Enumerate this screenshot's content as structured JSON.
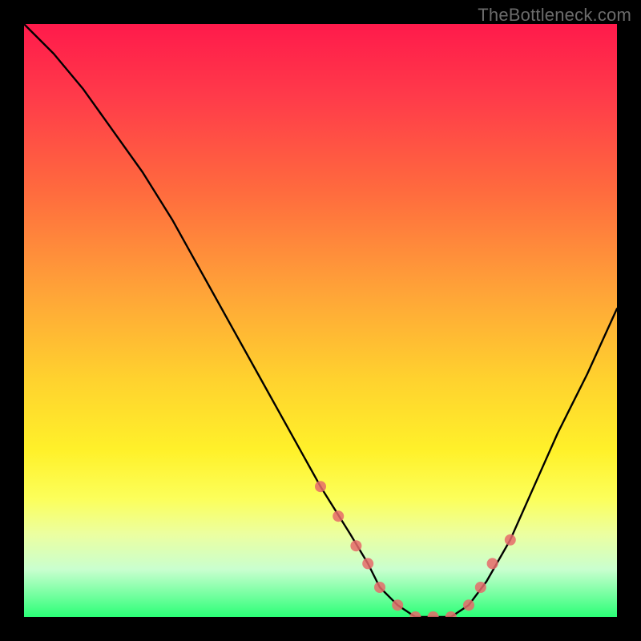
{
  "watermark": "TheBottleneck.com",
  "chart_data": {
    "type": "line",
    "title": "",
    "xlabel": "",
    "ylabel": "",
    "xlim": [
      0,
      100
    ],
    "ylim": [
      0,
      100
    ],
    "series": [
      {
        "name": "bottleneck-curve",
        "x": [
          0,
          5,
          10,
          15,
          20,
          25,
          30,
          35,
          40,
          45,
          50,
          55,
          58,
          60,
          63,
          66,
          69,
          72,
          75,
          78,
          82,
          86,
          90,
          95,
          100
        ],
        "y": [
          100,
          95,
          89,
          82,
          75,
          67,
          58,
          49,
          40,
          31,
          22,
          14,
          9,
          5,
          2,
          0,
          0,
          0,
          2,
          6,
          13,
          22,
          31,
          41,
          52
        ]
      }
    ],
    "markers": {
      "name": "highlight-dots",
      "x": [
        50,
        53,
        56,
        58,
        60,
        63,
        66,
        69,
        72,
        75,
        77,
        79,
        82
      ],
      "y": [
        22,
        17,
        12,
        9,
        5,
        2,
        0,
        0,
        0,
        2,
        5,
        9,
        13
      ]
    },
    "marker_color": "#e66a6a",
    "curve_color": "#000000"
  }
}
